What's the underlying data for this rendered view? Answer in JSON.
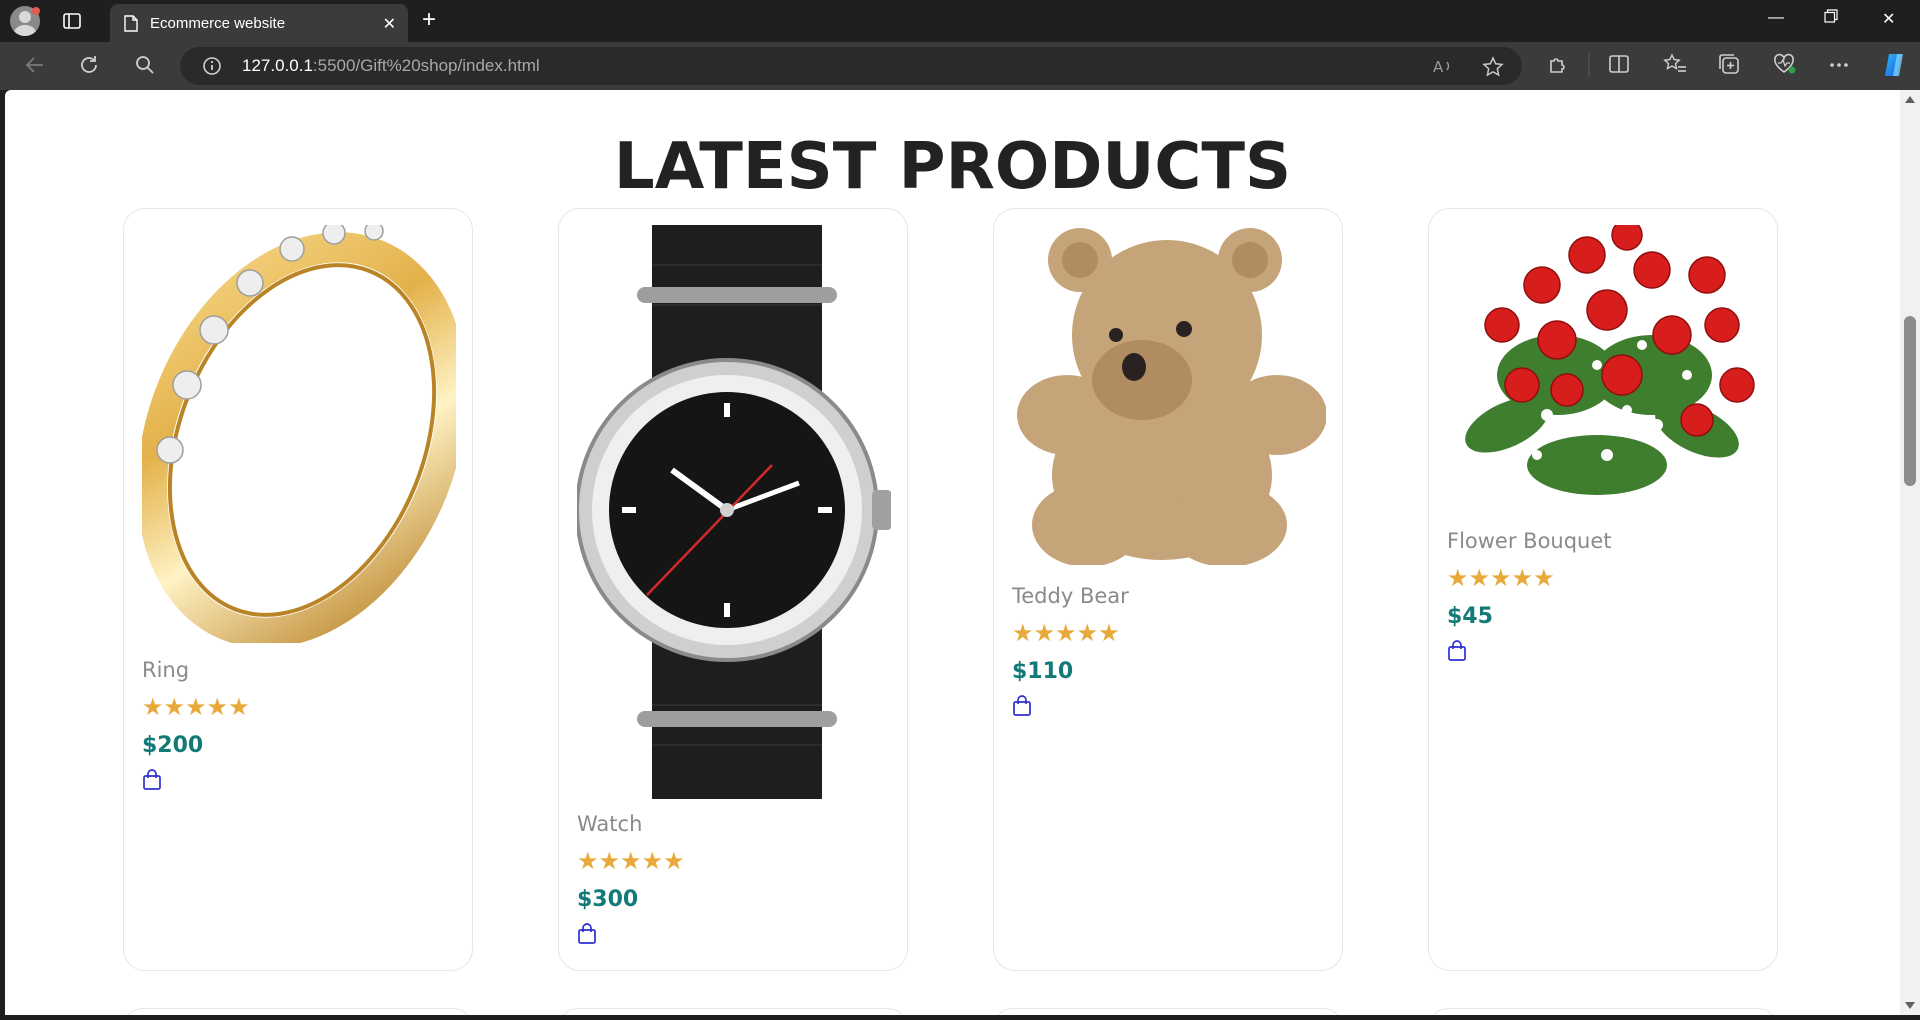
{
  "browser": {
    "tab_title": "Ecommerce website",
    "url_host": "127.0.0.1",
    "url_rest": ":5500/Gift%20shop/index.html"
  },
  "page": {
    "title": "LATEST PRODUCTS"
  },
  "products": [
    {
      "name": "Ring",
      "rating": "★★★★★",
      "price": "$200",
      "image": "ring-image"
    },
    {
      "name": "Watch",
      "rating": "★★★★★",
      "price": "$300",
      "image": "watch-image"
    },
    {
      "name": "Teddy Bear",
      "rating": "★★★★★",
      "price": "$110",
      "image": "teddy-bear-image"
    },
    {
      "name": "Flower Bouquet",
      "rating": "★★★★★",
      "price": "$45",
      "image": "flower-bouquet-image"
    }
  ],
  "colors": {
    "price": "#137a78",
    "star": "#e8a93a",
    "cart_icon": "#2e2ecf"
  }
}
